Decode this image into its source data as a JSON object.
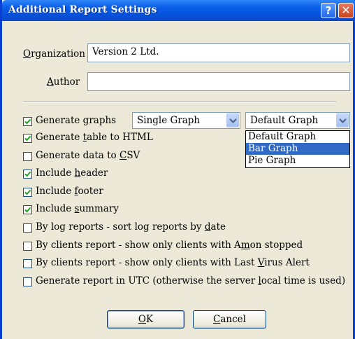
{
  "window": {
    "title": "Additional Report Settings",
    "help_icon": "help-icon",
    "close_icon": "close-icon"
  },
  "organization": {
    "label_pre": "",
    "label_key": "O",
    "label_post": "rganization",
    "value": "Version 2 Ltd."
  },
  "author": {
    "label_pre": "",
    "label_key": "A",
    "label_post": "uthor",
    "value": ""
  },
  "graphs": {
    "checked": true,
    "label_pre": "Generate ",
    "label_key": "g",
    "label_post": "raphs",
    "mode_value": "Single Graph",
    "type_value": "Default Graph",
    "type_options": [
      "Default Graph",
      "Bar Graph",
      "Pie Graph"
    ],
    "highlighted_option": "Bar Graph"
  },
  "options": [
    {
      "checked": true,
      "pre": "Generate ",
      "key": "t",
      "post": "able to HTML"
    },
    {
      "checked": false,
      "pre": "Generate data to ",
      "key": "C",
      "post": "SV"
    },
    {
      "checked": true,
      "pre": "Include ",
      "key": "h",
      "post": "eader"
    },
    {
      "checked": true,
      "pre": "Include ",
      "key": "f",
      "post": "ooter"
    },
    {
      "checked": true,
      "pre": "Include ",
      "key": "s",
      "post": "ummary"
    },
    {
      "checked": false,
      "pre": "By log reports - sort log reports by ",
      "key": "d",
      "post": "ate"
    },
    {
      "checked": false,
      "pre": "By clients report - show only clients with A",
      "key": "m",
      "post": "on stopped"
    },
    {
      "checked": false,
      "pre": "By clients report - show only clients with Last ",
      "key": "V",
      "post": "irus Alert"
    },
    {
      "checked": false,
      "pre": "Generate report in UTC (otherwise the server ",
      "key": "l",
      "post": "ocal time is used)"
    }
  ],
  "buttons": {
    "ok": {
      "pre": "",
      "key": "O",
      "post": "K"
    },
    "cancel": {
      "pre": "",
      "key": "C",
      "post": "ancel"
    }
  },
  "colors": {
    "title_bar": "#0a5ee8",
    "dialog_bg": "#ece9d8",
    "highlight": "#316ac5",
    "check": "#21a121"
  }
}
